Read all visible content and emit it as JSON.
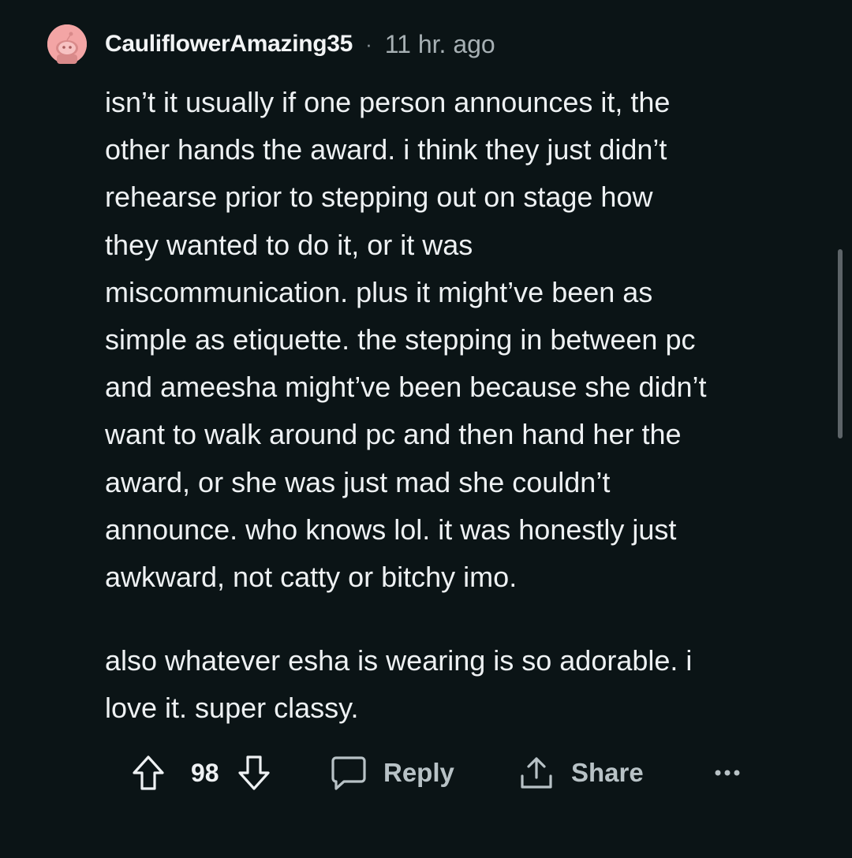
{
  "comment": {
    "author": "CauliflowerAmazing35",
    "separator": "·",
    "timestamp": "11 hr. ago",
    "avatar_icon": "snoo-avatar-icon",
    "avatar_color": "#f3a5a5",
    "paragraphs": [
      "isn’t it usually if one person announces it, the\nother hands the award. i think they just didn’t\nrehearse prior to stepping out on stage how\nthey wanted to do it, or it was\nmiscommunication. plus it might’ve been as\nsimple as etiquette. the stepping in between pc\nand ameesha might’ve been because she didn’t\nwant to walk around pc and then hand her the\naward, or she was just mad she couldn’t\nannounce. who knows lol. it was honestly just\nawkward, not catty or bitchy imo.",
      "also whatever esha is wearing is so adorable. i\nlove it. super classy."
    ]
  },
  "actions": {
    "upvote_icon": "upvote-arrow-icon",
    "vote_count": "98",
    "downvote_icon": "downvote-arrow-icon",
    "reply_icon": "speech-bubble-icon",
    "reply_label": "Reply",
    "share_icon": "share-arrow-icon",
    "share_label": "Share",
    "more_icon": "ellipsis-icon"
  },
  "colors": {
    "background": "#0b1416",
    "text": "#eef1f3",
    "muted": "#a7b0b4"
  }
}
